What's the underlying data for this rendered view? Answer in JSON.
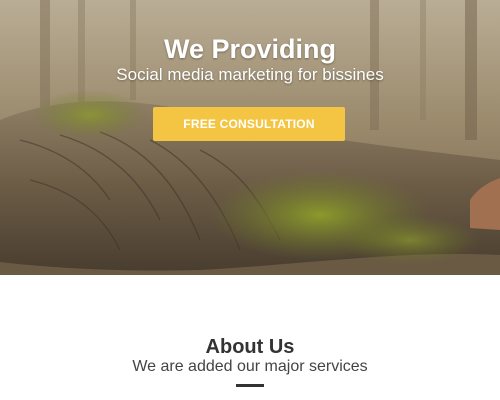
{
  "hero": {
    "title": "We Providing",
    "subtitle": "Social media marketing for bissines",
    "cta_label": "FREE CONSULTATION",
    "background_image": "forest-log-moss-photo",
    "accent_color": "#f4c542"
  },
  "about": {
    "title": "About Us",
    "subtitle": "We are added our major services",
    "divider_color": "#333333"
  }
}
